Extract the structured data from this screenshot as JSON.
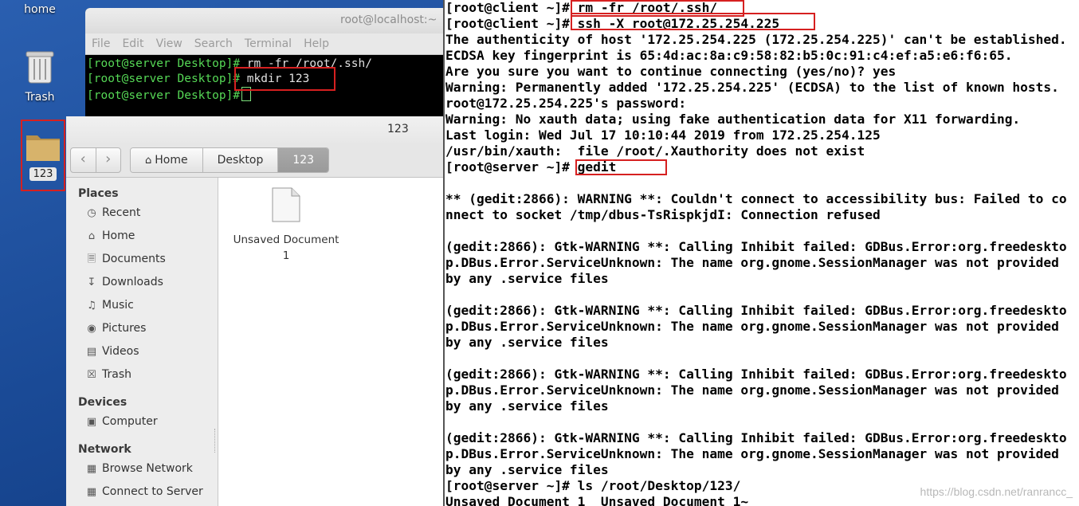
{
  "desktop": {
    "icons": [
      {
        "label": "home"
      },
      {
        "label": "Trash"
      },
      {
        "label": "123"
      }
    ]
  },
  "server_terminal": {
    "title": "root@localhost:~",
    "menu": [
      "File",
      "Edit",
      "View",
      "Search",
      "Terminal",
      "Help"
    ],
    "lines": [
      {
        "prompt": "[root@server Desktop]#",
        "cmd": " rm -fr /root/.ssh/"
      },
      {
        "prompt": "[root@server Desktop]#",
        "cmd": " mkdir 123"
      },
      {
        "prompt": "[root@server Desktop]#",
        "cmd": " "
      }
    ]
  },
  "file_manager": {
    "title": "123",
    "breadcrumbs": [
      "Home",
      "Desktop",
      "123"
    ],
    "sidebar": {
      "places_heading": "Places",
      "places": [
        {
          "label": "Recent",
          "icon": "clock-icon"
        },
        {
          "label": "Home",
          "icon": "home-icon"
        },
        {
          "label": "Documents",
          "icon": "document-icon"
        },
        {
          "label": "Downloads",
          "icon": "download-icon"
        },
        {
          "label": "Music",
          "icon": "music-icon"
        },
        {
          "label": "Pictures",
          "icon": "camera-icon"
        },
        {
          "label": "Videos",
          "icon": "film-icon"
        },
        {
          "label": "Trash",
          "icon": "trash-icon"
        }
      ],
      "devices_heading": "Devices",
      "devices": [
        {
          "label": "Computer",
          "icon": "drive-icon"
        }
      ],
      "network_heading": "Network",
      "network": [
        {
          "label": "Browse Network",
          "icon": "network-icon"
        },
        {
          "label": "Connect to Server",
          "icon": "server-icon"
        }
      ]
    },
    "files": [
      {
        "name_line1": "Unsaved Document",
        "name_line2": "1"
      }
    ]
  },
  "client_terminal": {
    "lines": [
      "[root@client ~]# rm -fr /root/.ssh/",
      "[root@client ~]# ssh -X root@172.25.254.225",
      "The authenticity of host '172.25.254.225 (172.25.254.225)' can't be established.",
      "ECDSA key fingerprint is 65:4d:ac:8a:c9:58:82:b5:0c:91:c4:ef:a5:e6:f6:65.",
      "Are you sure you want to continue connecting (yes/no)? yes",
      "Warning: Permanently added '172.25.254.225' (ECDSA) to the list of known hosts.",
      "root@172.25.254.225's password:",
      "Warning: No xauth data; using fake authentication data for X11 forwarding.",
      "Last login: Wed Jul 17 10:10:44 2019 from 172.25.254.125",
      "/usr/bin/xauth:  file /root/.Xauthority does not exist",
      "[root@server ~]# gedit",
      "",
      "** (gedit:2866): WARNING **: Couldn't connect to accessibility bus: Failed to co",
      "nnect to socket /tmp/dbus-TsRispkjdI: Connection refused",
      "",
      "(gedit:2866): Gtk-WARNING **: Calling Inhibit failed: GDBus.Error:org.freedeskto",
      "p.DBus.Error.ServiceUnknown: The name org.gnome.SessionManager was not provided",
      "by any .service files",
      "",
      "(gedit:2866): Gtk-WARNING **: Calling Inhibit failed: GDBus.Error:org.freedeskto",
      "p.DBus.Error.ServiceUnknown: The name org.gnome.SessionManager was not provided",
      "by any .service files",
      "",
      "(gedit:2866): Gtk-WARNING **: Calling Inhibit failed: GDBus.Error:org.freedeskto",
      "p.DBus.Error.ServiceUnknown: The name org.gnome.SessionManager was not provided",
      "by any .service files",
      "",
      "(gedit:2866): Gtk-WARNING **: Calling Inhibit failed: GDBus.Error:org.freedeskto",
      "p.DBus.Error.ServiceUnknown: The name org.gnome.SessionManager was not provided",
      "by any .service files",
      "[root@server ~]# ls /root/Desktop/123/",
      "Unsaved Document 1  Unsaved Document 1~"
    ],
    "watermark": "https://blog.csdn.net/ranrancc_"
  },
  "colors": {
    "highlight_box": "#d62020",
    "prompt_green": "#56d856"
  }
}
